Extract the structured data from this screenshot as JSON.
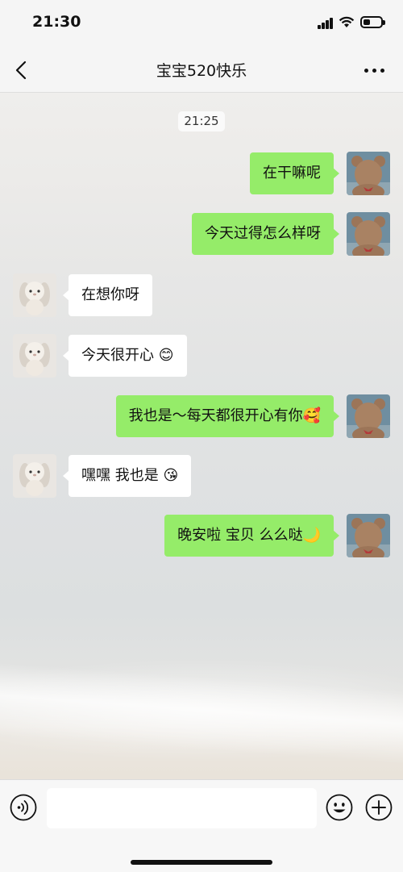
{
  "status_bar": {
    "time": "21:30",
    "battery_level": 0.4
  },
  "header": {
    "title": "宝宝520快乐",
    "back_icon": "chevron-left-icon",
    "more_icon": "more-dots-icon"
  },
  "chat": {
    "timestamp": "21:25",
    "messages": [
      {
        "sender": "me",
        "text": "在干嘛呢"
      },
      {
        "sender": "me",
        "text": "今天过得怎么样呀"
      },
      {
        "sender": "other",
        "text": "在想你呀"
      },
      {
        "sender": "other",
        "text": "今天很开心 😊"
      },
      {
        "sender": "me",
        "text": "我也是～每天都很开心有你🥰"
      },
      {
        "sender": "other",
        "text": "嘿嘿 我也是 😘"
      },
      {
        "sender": "me",
        "text": "晚安啦 宝贝 么么哒🌙"
      }
    ],
    "my_avatar": "teddy-bear-avatar",
    "other_avatar": "plush-bunny-avatar"
  },
  "input_bar": {
    "voice_icon": "voice-icon",
    "text_value": "",
    "emoji_icon": "emoji-icon",
    "plus_icon": "plus-icon"
  },
  "colors": {
    "my_bubble": "#95ec69",
    "other_bubble": "#ffffff",
    "bar_bg": "#f5f5f5"
  }
}
